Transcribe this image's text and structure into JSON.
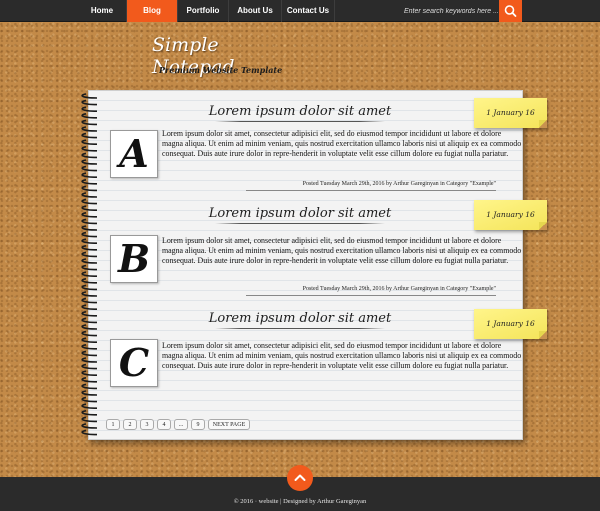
{
  "nav": {
    "items": [
      {
        "label": "Home"
      },
      {
        "label": "Blog"
      },
      {
        "label": "Portfolio"
      },
      {
        "label": "About Us"
      },
      {
        "label": "Contact Us"
      }
    ],
    "active_index": 1,
    "search_placeholder": "Enter search keywords here ....",
    "search_icon": "magnifier-icon"
  },
  "logo": {
    "title": "Simple Notepad",
    "subtitle": "Premium Website Template"
  },
  "posts": [
    {
      "title": "Lorem ipsum dolor sit amet",
      "date": "1 January 16",
      "letter": "A",
      "body": "Lorem ipsum dolor sit amet, consectetur adipisici elit, sed do eiusmod tempor incididunt ut labore et dolore magna aliqua. Ut enim ad minim veniam, quis nostrud exercitation ullamco laboris nisi ut aliquip ex ea commodo consequat. Duis aute irure dolor in repre-henderit in voluptate velit esse cillum dolore eu fugiat nulla pariatur.",
      "meta": "Posted Tuesday March 29th, 2016 by Arthur Gareginyan in Category \"Example\""
    },
    {
      "title": "Lorem ipsum dolor sit amet",
      "date": "1 January 16",
      "letter": "B",
      "body": "Lorem ipsum dolor sit amet, consectetur adipisici elit, sed do eiusmod tempor incididunt ut labore et dolore magna aliqua. Ut enim ad minim veniam, quis nostrud exercitation ullamco laboris nisi ut aliquip ex ea commodo consequat. Duis aute irure dolor in repre-henderit in voluptate velit esse cillum dolore eu fugiat nulla pariatur.",
      "meta": "Posted Tuesday March 29th, 2016 by Arthur Gareginyan in Category \"Example\""
    },
    {
      "title": "Lorem ipsum dolor sit amet",
      "date": "1 January 16",
      "letter": "C",
      "body": "Lorem ipsum dolor sit amet, consectetur adipisici elit, sed do eiusmod tempor incididunt ut labore et dolore magna aliqua. Ut enim ad minim veniam, quis nostrud exercitation ullamco laboris nisi ut aliquip ex ea commodo consequat. Duis aute irure dolor in repre-henderit in voluptate velit esse cillum dolore eu fugiat nulla pariatur.",
      "meta": ""
    }
  ],
  "pagination": {
    "pages": [
      "1",
      "2",
      "3",
      "4",
      "...",
      "9"
    ],
    "next_label": "NEXT PAGE"
  },
  "footer": {
    "text": "© 2016 · website | Designed by Arthur Gareginyan",
    "scroll_top_icon": "chevron-up-icon"
  },
  "colors": {
    "accent": "#f25a1c",
    "nav_bg": "#2b2b2b",
    "cork": "#c38a48",
    "sticky_note": "#fff58a"
  }
}
